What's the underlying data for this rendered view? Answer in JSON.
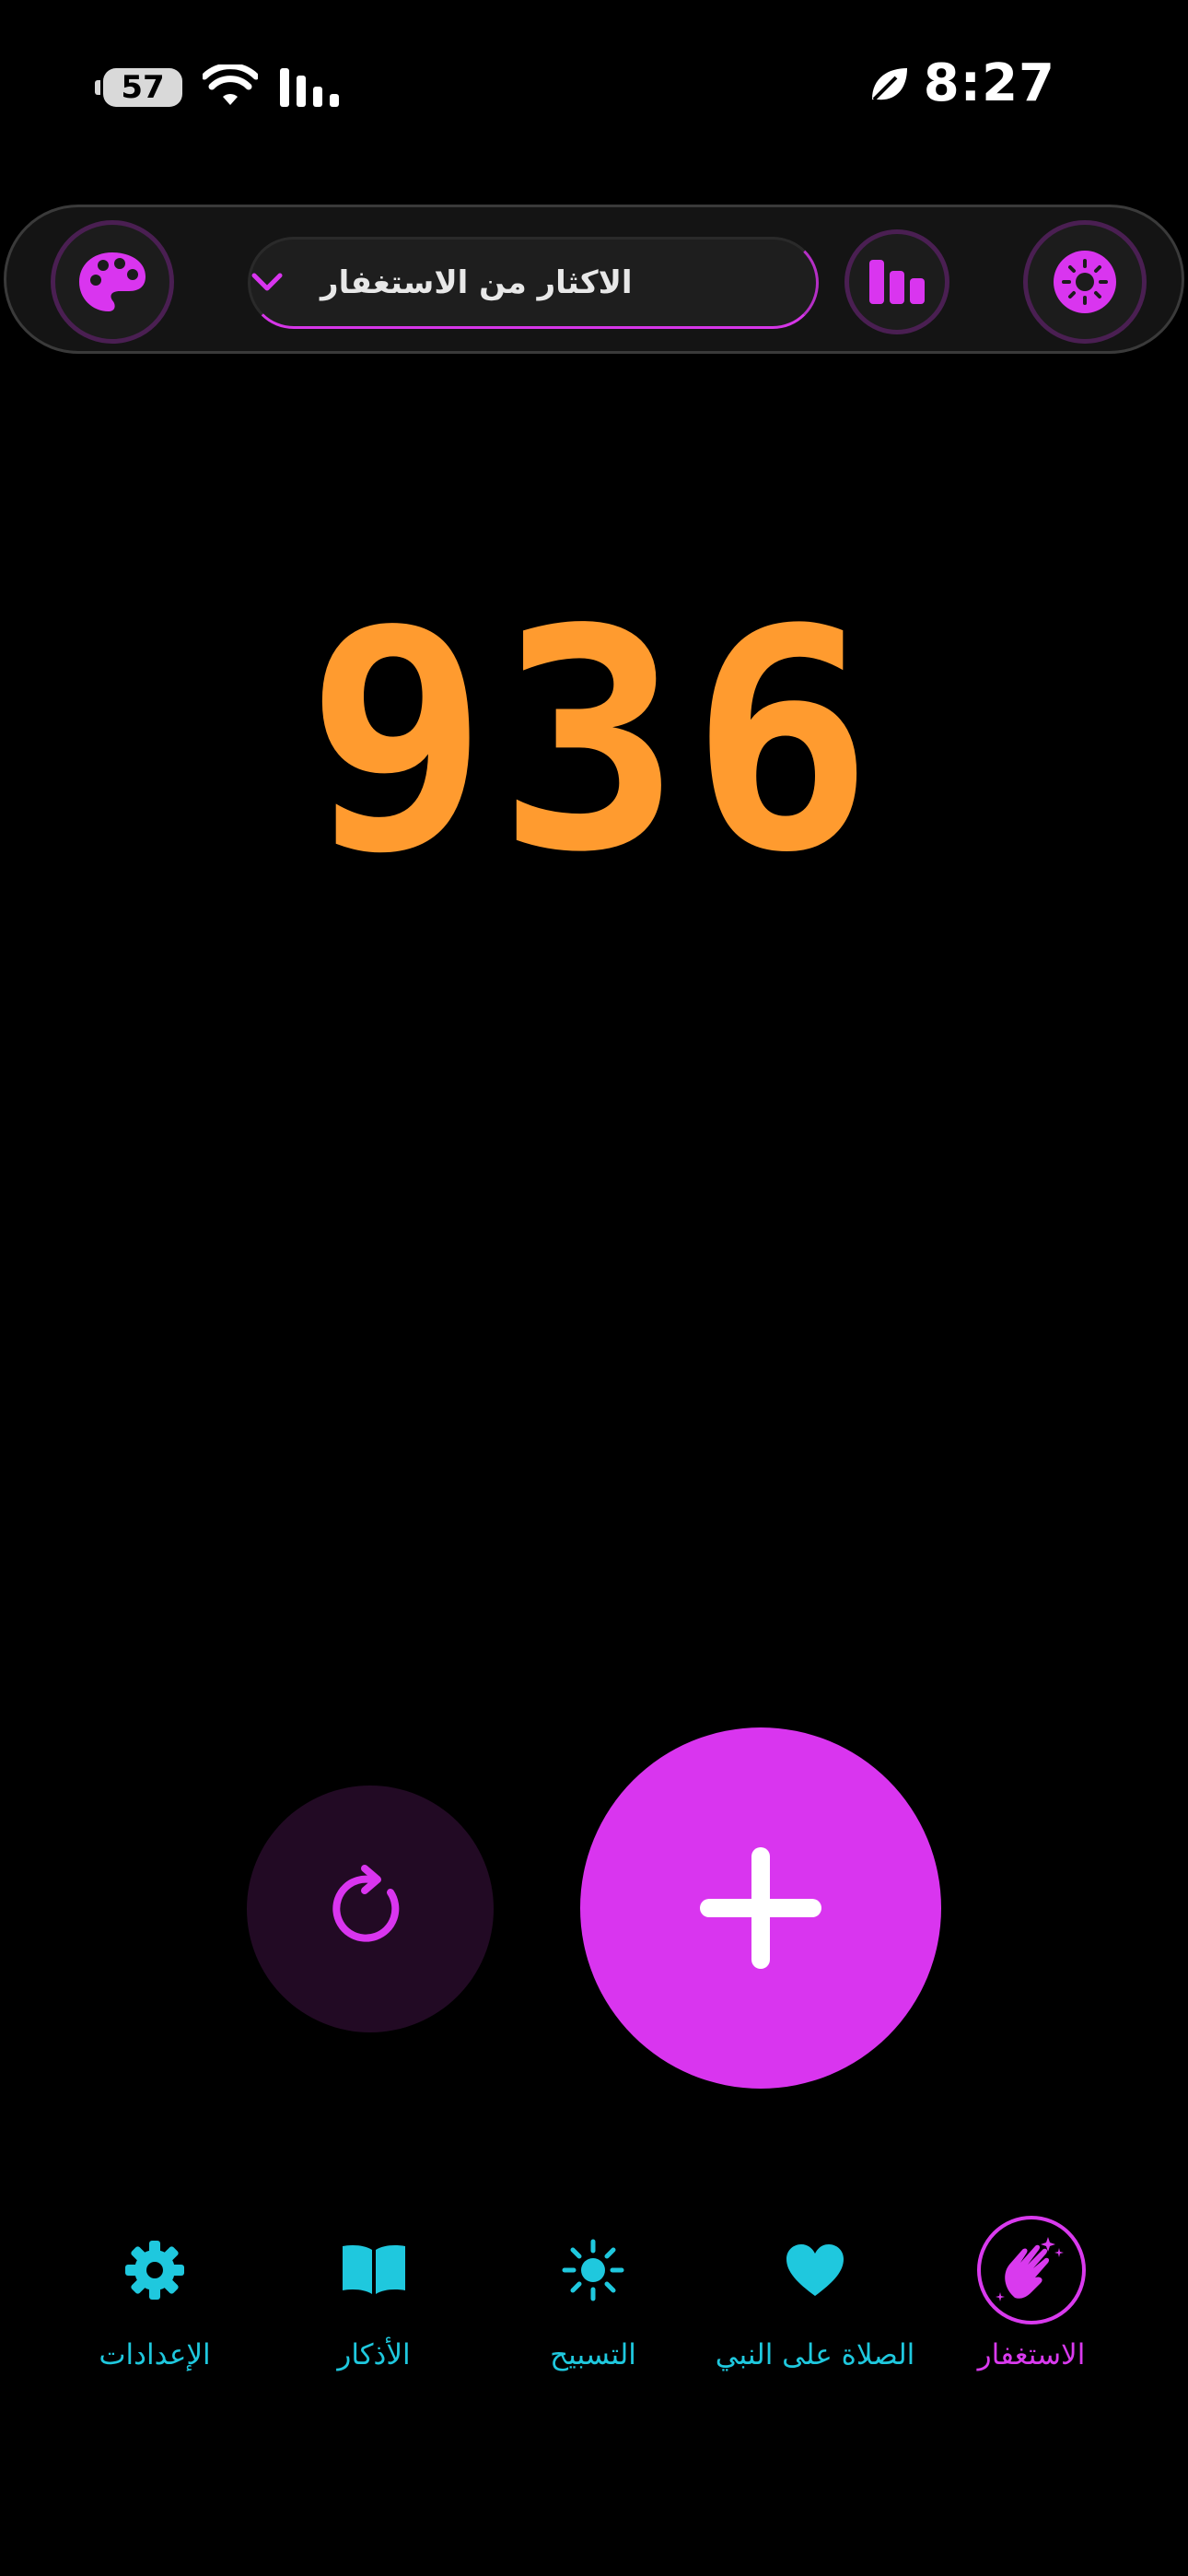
{
  "status_bar": {
    "battery": "57",
    "time": "8:27"
  },
  "toolbar": {
    "dropdown_label": "الاكثار من الاستغفار",
    "palette_icon": "palette-icon",
    "stats_icon": "bar-chart-icon",
    "brightness_icon": "brightness-icon"
  },
  "counter": {
    "value": "936",
    "color": "#ff9b2f"
  },
  "actions": {
    "reset_icon": "refresh-icon",
    "increment_icon": "plus-icon",
    "accent": "#d935ef"
  },
  "bottom_nav": {
    "items": [
      {
        "label": "الاستغفار",
        "icon": "clapping-hands-icon",
        "active": true
      },
      {
        "label": "الصلاة على النبي",
        "icon": "heart-icon",
        "active": false
      },
      {
        "label": "التسبيح",
        "icon": "sun-icon",
        "active": false
      },
      {
        "label": "الأذكار",
        "icon": "book-icon",
        "active": false
      },
      {
        "label": "الإعدادات",
        "icon": "gear-icon",
        "active": false
      }
    ],
    "active_color": "#d93aee",
    "inactive_color": "#1fc8de"
  }
}
